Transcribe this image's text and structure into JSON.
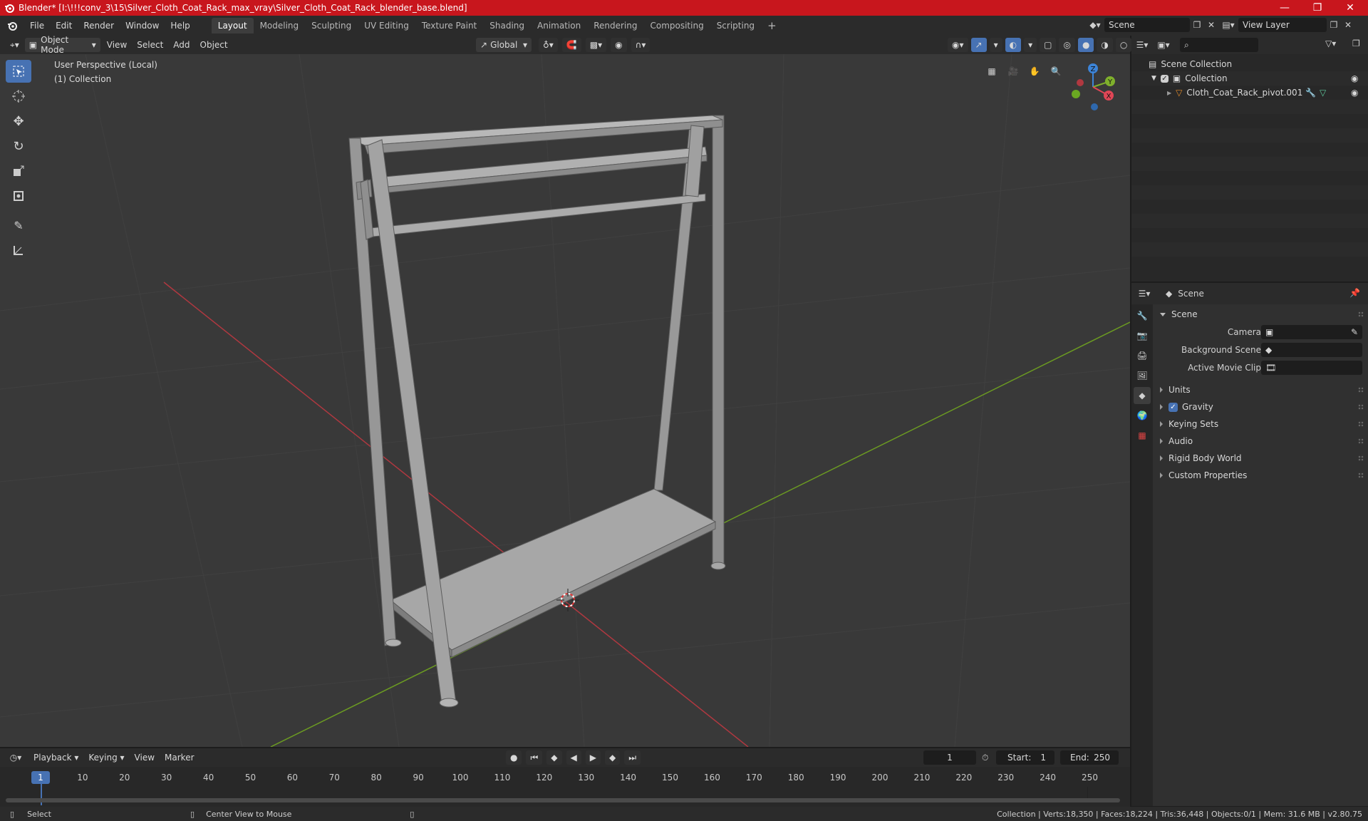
{
  "window": {
    "title": "Blender* [I:\\!!!conv_3\\15\\Silver_Cloth_Coat_Rack_max_vray\\Silver_Cloth_Coat_Rack_blender_base.blend]"
  },
  "menu": [
    "File",
    "Edit",
    "Render",
    "Window",
    "Help"
  ],
  "workspaces": [
    "Layout",
    "Modeling",
    "Sculpting",
    "UV Editing",
    "Texture Paint",
    "Shading",
    "Animation",
    "Rendering",
    "Compositing",
    "Scripting"
  ],
  "active_workspace": "Layout",
  "scene_field": "Scene",
  "view_layer_field": "View Layer",
  "viewport_header": {
    "mode": "Object Mode",
    "menus": [
      "View",
      "Select",
      "Add",
      "Object"
    ],
    "transform_orientation": "Global"
  },
  "viewport": {
    "perspective_label": "User Perspective (Local)",
    "collection_label": "(1) Collection",
    "gizmo_axes": {
      "x": "X",
      "y": "Y",
      "z": "Z"
    }
  },
  "outliner": {
    "rows": [
      {
        "label": "Scene Collection"
      },
      {
        "label": "Collection"
      },
      {
        "label": "Cloth_Coat_Rack_pivot.001"
      }
    ]
  },
  "properties": {
    "header": "Scene",
    "panel_scene": "Scene",
    "fields": [
      {
        "label": "Camera"
      },
      {
        "label": "Background Scene"
      },
      {
        "label": "Active Movie Clip"
      }
    ],
    "panels": [
      "Units",
      "Gravity",
      "Keying Sets",
      "Audio",
      "Rigid Body World",
      "Custom Properties"
    ]
  },
  "timeline": {
    "menus": [
      "Playback",
      "Keying",
      "View",
      "Marker"
    ],
    "current_frame": "1",
    "start_label": "Start:",
    "start_value": "1",
    "end_label": "End:",
    "end_value": "250",
    "frame_ticks": [
      "1",
      "10",
      "20",
      "30",
      "40",
      "50",
      "60",
      "70",
      "80",
      "90",
      "100",
      "110",
      "120",
      "130",
      "140",
      "150",
      "160",
      "170",
      "180",
      "190",
      "200",
      "210",
      "220",
      "230",
      "240",
      "250"
    ]
  },
  "statusbar": {
    "left": "Select",
    "middle": "Center View to Mouse",
    "right": "Collection | Verts:18,350 | Faces:18,224 | Tris:36,448 | Objects:0/1 | Mem: 31.6 MB | v2.80.75"
  },
  "colors": {
    "title_bar": "#c8161d",
    "accent": "#4772b3",
    "x_axis": "#e04656",
    "y_axis": "#7fb02c",
    "z_axis": "#3c84d8"
  }
}
